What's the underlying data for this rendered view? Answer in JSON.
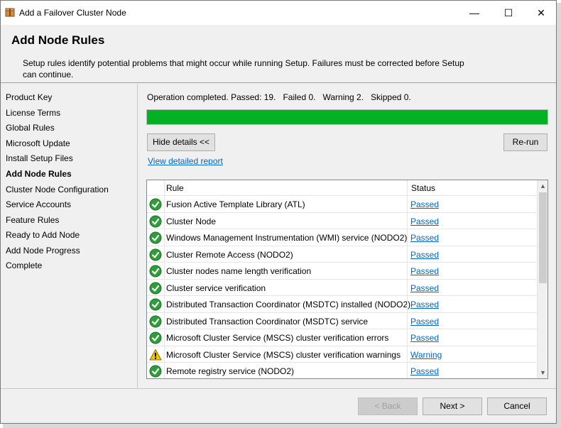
{
  "window": {
    "title": "Add a Failover Cluster Node",
    "minimize_glyph": "—",
    "maximize_glyph": "☐",
    "close_glyph": "✕"
  },
  "header": {
    "title": "Add Node Rules",
    "description": "Setup rules identify potential problems that might occur while running Setup. Failures must be corrected before Setup can continue."
  },
  "nav": {
    "items": [
      {
        "label": "Product Key"
      },
      {
        "label": "License Terms"
      },
      {
        "label": "Global Rules"
      },
      {
        "label": "Microsoft Update"
      },
      {
        "label": "Install Setup Files"
      },
      {
        "label": "Add Node Rules",
        "active": true
      },
      {
        "label": "Cluster Node Configuration"
      },
      {
        "label": "Service Accounts"
      },
      {
        "label": "Feature Rules"
      },
      {
        "label": "Ready to Add Node"
      },
      {
        "label": "Add Node Progress"
      },
      {
        "label": "Complete"
      }
    ]
  },
  "main": {
    "operation_status": "Operation completed. Passed: 19.   Failed 0.   Warning 2.   Skipped 0.",
    "progress_fraction": 1.0,
    "progress_color": "#06b025",
    "hide_details_label": "Hide details <<",
    "rerun_label": "Re-run",
    "report_link": "View detailed report"
  },
  "grid": {
    "columns": {
      "rule": "Rule",
      "status": "Status"
    },
    "rows": [
      {
        "icon": "passed-check-icon",
        "rule": "Fusion Active Template Library (ATL)",
        "status": "Passed"
      },
      {
        "icon": "passed-check-icon",
        "rule": "Cluster Node",
        "status": "Passed"
      },
      {
        "icon": "passed-check-icon",
        "rule": "Windows Management Instrumentation (WMI) service (NODO2)",
        "status": "Passed"
      },
      {
        "icon": "passed-check-icon",
        "rule": "Cluster Remote Access (NODO2)",
        "status": "Passed"
      },
      {
        "icon": "passed-check-icon",
        "rule": "Cluster nodes name length verification",
        "status": "Passed"
      },
      {
        "icon": "passed-check-icon",
        "rule": "Cluster service verification",
        "status": "Passed"
      },
      {
        "icon": "passed-check-icon",
        "rule": "Distributed Transaction Coordinator (MSDTC) installed (NODO2)",
        "status": "Passed"
      },
      {
        "icon": "passed-check-icon",
        "rule": "Distributed Transaction Coordinator (MSDTC) service",
        "status": "Passed"
      },
      {
        "icon": "passed-check-icon",
        "rule": "Microsoft Cluster Service (MSCS) cluster verification errors",
        "status": "Passed"
      },
      {
        "icon": "warning-triangle-icon",
        "rule": "Microsoft Cluster Service (MSCS) cluster verification warnings",
        "status": "Warning"
      },
      {
        "icon": "passed-check-icon",
        "rule": "Remote registry service (NODO2)",
        "status": "Passed"
      }
    ]
  },
  "footer": {
    "back_label": "< Back",
    "next_label": "Next >",
    "cancel_label": "Cancel"
  },
  "colors": {
    "passed": "#2e9e3a",
    "warning": "#f5c400",
    "link": "#0066cc"
  }
}
